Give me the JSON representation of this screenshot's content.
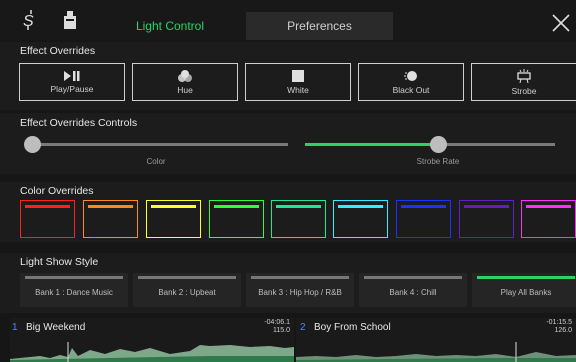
{
  "top_bar": {
    "tabs": [
      {
        "label": "Light Control",
        "active": true
      },
      {
        "label": "Preferences",
        "active": false
      }
    ],
    "icons": [
      "logo-icon",
      "controller-icon",
      "close-icon"
    ]
  },
  "effect_overrides": {
    "title": "Effect Overrides",
    "buttons": [
      {
        "label": "Play/Pause",
        "icon": "play-pause-icon"
      },
      {
        "label": "Hue",
        "icon": "hue-icon"
      },
      {
        "label": "White",
        "icon": "white-icon"
      },
      {
        "label": "Black Out",
        "icon": "blackout-icon"
      },
      {
        "label": "Strobe",
        "icon": "strobe-icon"
      }
    ]
  },
  "effect_controls": {
    "title": "Effect Overrides Controls",
    "sliders": [
      {
        "label": "Color",
        "value": 0.0
      },
      {
        "label": "Strobe Rate",
        "value": 0.5
      }
    ]
  },
  "color_overrides": {
    "title": "Color Overrides",
    "colors": [
      "#ff2020",
      "#ff8a1a",
      "#ffff30",
      "#30ff30",
      "#20e890",
      "#30f0ff",
      "#2030ff",
      "#6020c0",
      "#ff30ff"
    ]
  },
  "light_show": {
    "title": "Light Show Style",
    "banks": [
      {
        "label": "Bank 1 : Dance Music",
        "active": false
      },
      {
        "label": "Bank 2 : Upbeat",
        "active": false
      },
      {
        "label": "Bank 3 : Hip Hop / R&B",
        "active": false
      },
      {
        "label": "Bank 4 : Chill",
        "active": false
      },
      {
        "label": "Play All Banks",
        "active": true
      }
    ]
  },
  "decks": [
    {
      "number": "1",
      "title": "Big Weekend",
      "time": "-04:06.1",
      "bpm": "115.0"
    },
    {
      "number": "2",
      "title": "Boy From School",
      "time": "-01:15.5",
      "bpm": "126.0"
    }
  ],
  "colors": {
    "accent": "#2ed06a",
    "deck_number": "#3a8fff"
  }
}
